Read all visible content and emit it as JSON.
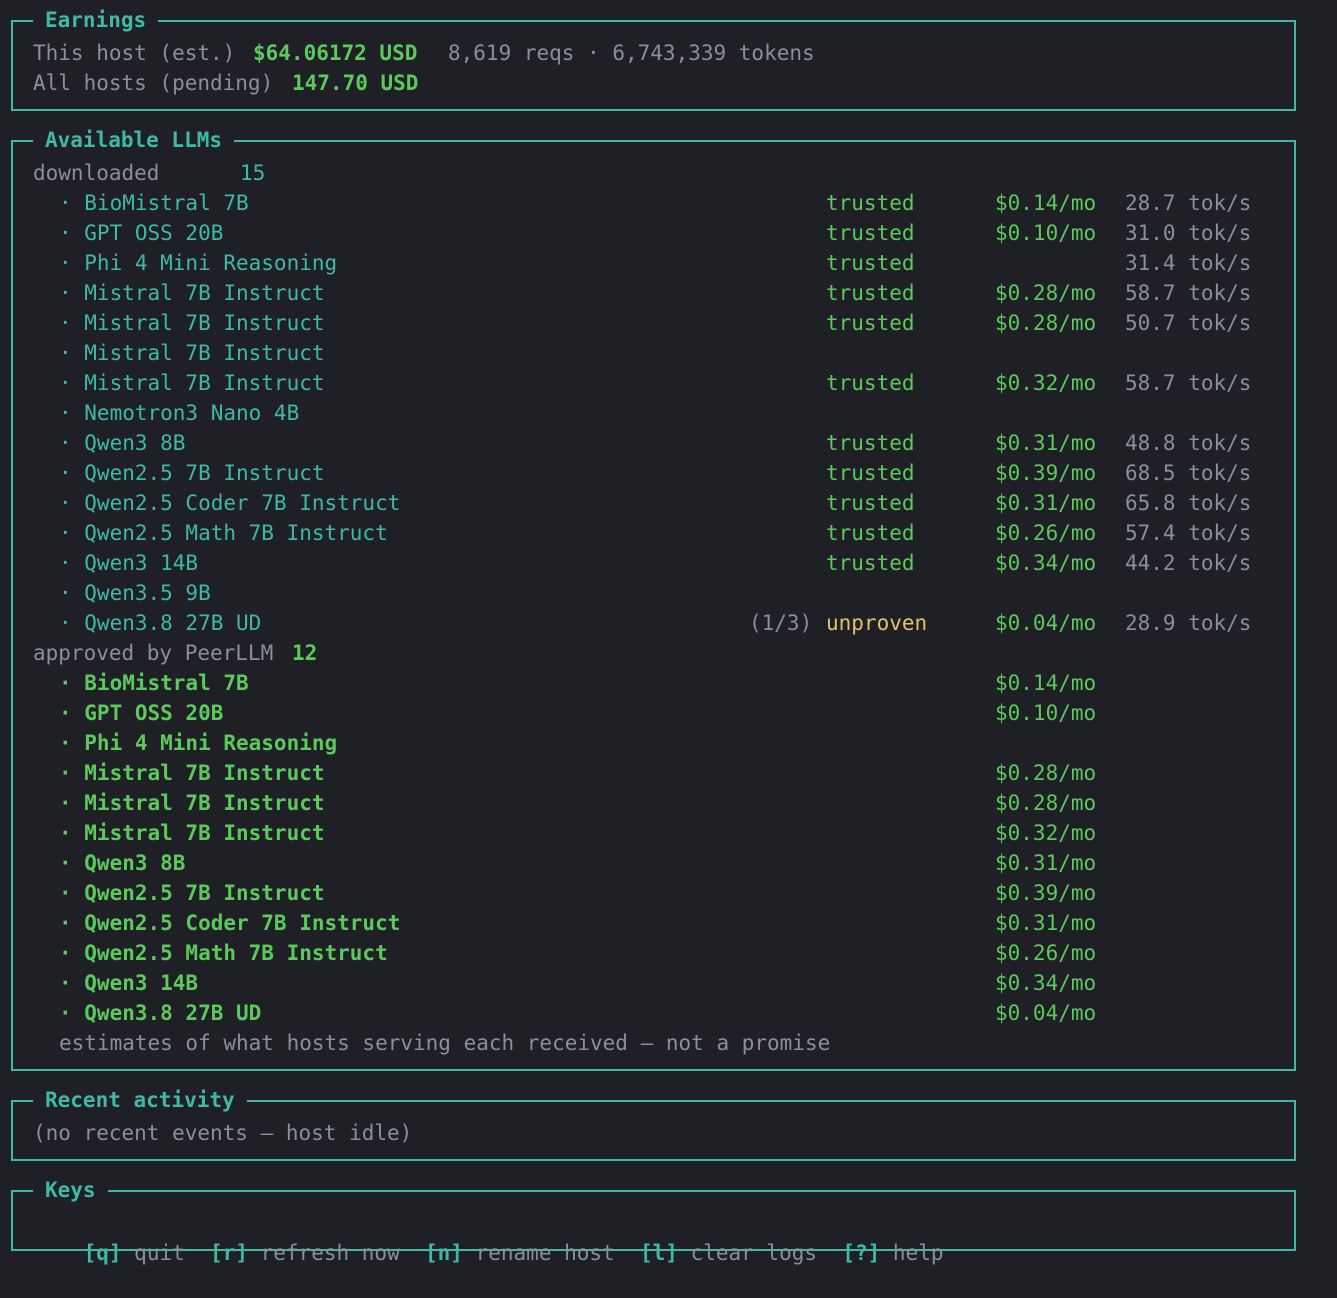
{
  "earnings": {
    "title": "Earnings",
    "this_host_label": "This host (est.)",
    "this_host_amount": "$64.06172 USD",
    "this_host_stats": "8,619 reqs · 6,743,339 tokens",
    "all_hosts_label": "All hosts (pending)",
    "all_hosts_amount": "147.70 USD"
  },
  "llms": {
    "title": "Available LLMs",
    "downloaded_label": "downloaded",
    "downloaded_count": "15",
    "downloaded": [
      {
        "name": "· BioMistral 7B",
        "attempt": "",
        "status": "trusted",
        "price": "$0.14/mo",
        "speed": "28.7 tok/s"
      },
      {
        "name": "· GPT OSS 20B",
        "attempt": "",
        "status": "trusted",
        "price": "$0.10/mo",
        "speed": "31.0 tok/s"
      },
      {
        "name": "· Phi 4 Mini Reasoning",
        "attempt": "",
        "status": "trusted",
        "price": "",
        "speed": "31.4 tok/s"
      },
      {
        "name": "· Mistral 7B Instruct",
        "attempt": "",
        "status": "trusted",
        "price": "$0.28/mo",
        "speed": "58.7 tok/s"
      },
      {
        "name": "· Mistral 7B Instruct",
        "attempt": "",
        "status": "trusted",
        "price": "$0.28/mo",
        "speed": "50.7 tok/s"
      },
      {
        "name": "· Mistral 7B Instruct",
        "attempt": "",
        "status": "",
        "price": "",
        "speed": ""
      },
      {
        "name": "· Mistral 7B Instruct",
        "attempt": "",
        "status": "trusted",
        "price": "$0.32/mo",
        "speed": "58.7 tok/s"
      },
      {
        "name": "· Nemotron3 Nano 4B",
        "attempt": "",
        "status": "",
        "price": "",
        "speed": ""
      },
      {
        "name": "· Qwen3 8B",
        "attempt": "",
        "status": "trusted",
        "price": "$0.31/mo",
        "speed": "48.8 tok/s"
      },
      {
        "name": "· Qwen2.5 7B Instruct",
        "attempt": "",
        "status": "trusted",
        "price": "$0.39/mo",
        "speed": "68.5 tok/s"
      },
      {
        "name": "· Qwen2.5 Coder 7B Instruct",
        "attempt": "",
        "status": "trusted",
        "price": "$0.31/mo",
        "speed": "65.8 tok/s"
      },
      {
        "name": "· Qwen2.5 Math 7B Instruct",
        "attempt": "",
        "status": "trusted",
        "price": "$0.26/mo",
        "speed": "57.4 tok/s"
      },
      {
        "name": "· Qwen3 14B",
        "attempt": "",
        "status": "trusted",
        "price": "$0.34/mo",
        "speed": "44.2 tok/s"
      },
      {
        "name": "· Qwen3.5 9B",
        "attempt": "",
        "status": "",
        "price": "",
        "speed": ""
      },
      {
        "name": "· Qwen3.8 27B UD",
        "attempt": "(1/3)",
        "status": "unproven",
        "price": "$0.04/mo",
        "speed": "28.9 tok/s"
      }
    ],
    "approved_label": "approved by PeerLLM",
    "approved_count": "12",
    "approved": [
      {
        "name": "· BioMistral 7B",
        "price": "$0.14/mo"
      },
      {
        "name": "· GPT OSS 20B",
        "price": "$0.10/mo"
      },
      {
        "name": "· Phi 4 Mini Reasoning",
        "price": ""
      },
      {
        "name": "· Mistral 7B Instruct",
        "price": "$0.28/mo"
      },
      {
        "name": "· Mistral 7B Instruct",
        "price": "$0.28/mo"
      },
      {
        "name": "· Mistral 7B Instruct",
        "price": "$0.32/mo"
      },
      {
        "name": "· Qwen3 8B",
        "price": "$0.31/mo"
      },
      {
        "name": "· Qwen2.5 7B Instruct",
        "price": "$0.39/mo"
      },
      {
        "name": "· Qwen2.5 Coder 7B Instruct",
        "price": "$0.31/mo"
      },
      {
        "name": "· Qwen2.5 Math 7B Instruct",
        "price": "$0.26/mo"
      },
      {
        "name": "· Qwen3 14B",
        "price": "$0.34/mo"
      },
      {
        "name": "· Qwen3.8 27B UD",
        "price": "$0.04/mo"
      }
    ],
    "footnote": "estimates of what hosts serving each received — not a promise"
  },
  "activity": {
    "title": "Recent activity",
    "empty_text": "(no recent events — host idle)"
  },
  "keys": {
    "title": "Keys",
    "items": [
      {
        "key": "[q]",
        "label": "quit"
      },
      {
        "key": "[r]",
        "label": "refresh now"
      },
      {
        "key": "[n]",
        "label": "rename host"
      },
      {
        "key": "[l]",
        "label": "clear logs"
      },
      {
        "key": "[?]",
        "label": "help"
      }
    ]
  },
  "colors": {
    "background": "#1e2025",
    "border": "#3fb8a8",
    "accent_teal": "#3fb8a8",
    "accent_green": "#5cc95c",
    "warning_yellow": "#e5c06a",
    "dim_text": "#8a8f98"
  }
}
